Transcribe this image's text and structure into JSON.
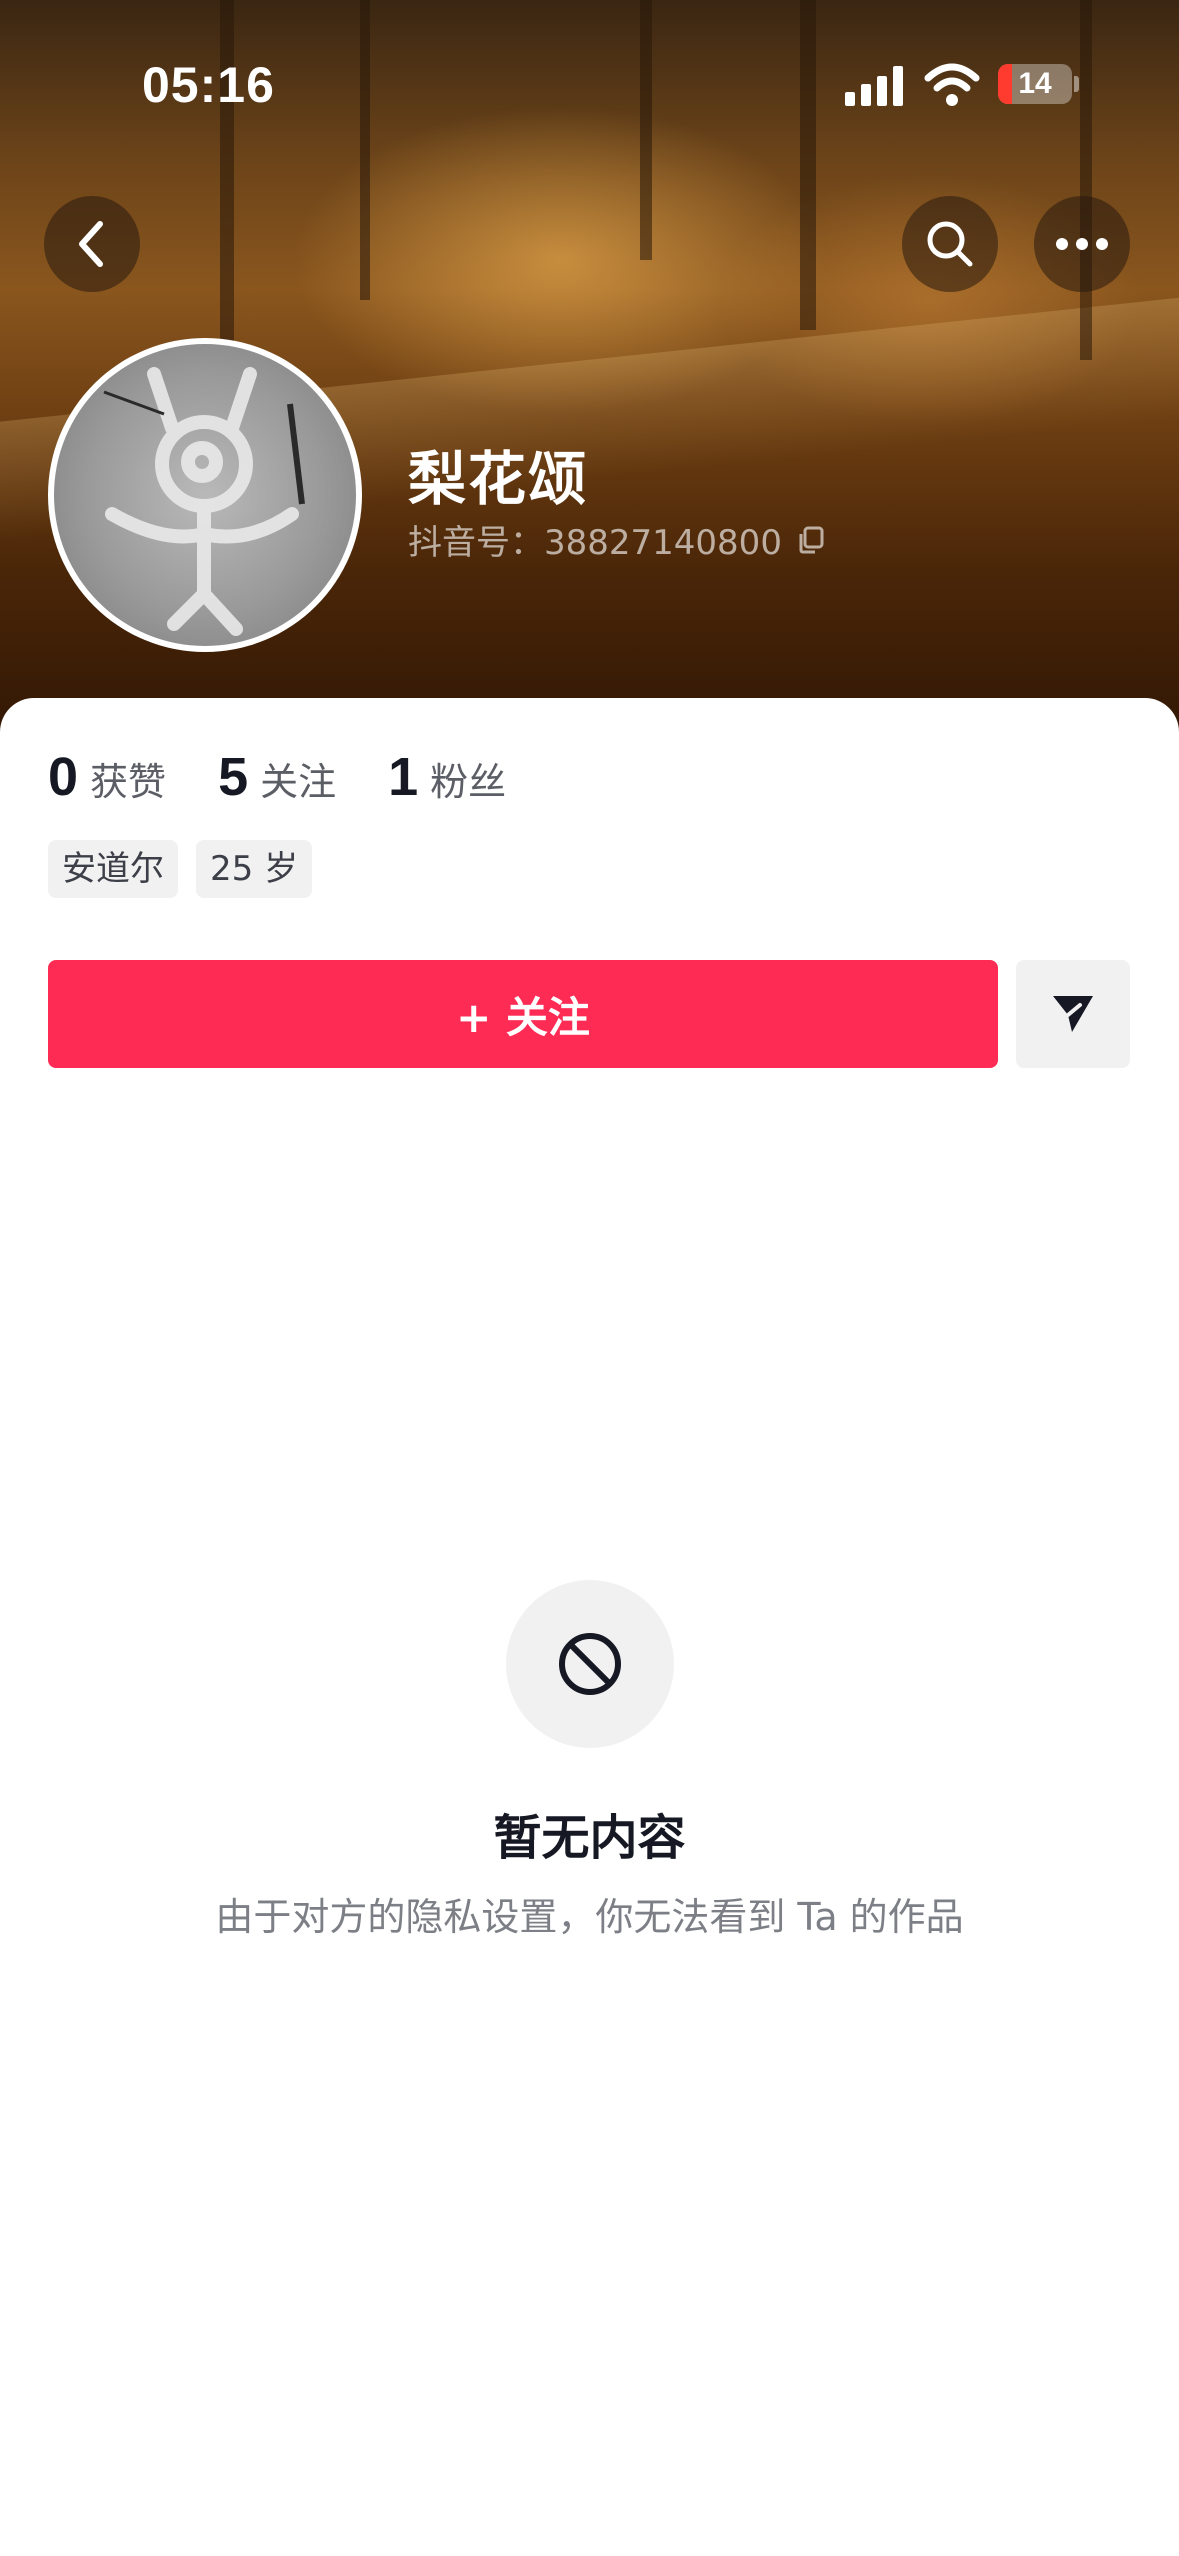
{
  "status_bar": {
    "time": "05:16",
    "battery": "14",
    "signal_icon": "cellular-signal-icon",
    "wifi_icon": "wifi-icon"
  },
  "nav": {
    "back_icon": "chevron-left-icon",
    "search_icon": "search-icon",
    "more_icon": "more-dots-icon"
  },
  "profile": {
    "name": "梨花颂",
    "douyin_id": "抖音号：38827140800",
    "copy_icon": "copy-icon"
  },
  "stats": [
    {
      "value": "0",
      "label": "获赞"
    },
    {
      "value": "5",
      "label": "关注"
    },
    {
      "value": "1",
      "label": "粉丝"
    }
  ],
  "tags": [
    "安道尔",
    "25 岁"
  ],
  "actions": {
    "follow_label": "+ 关注",
    "message_icon": "send-icon"
  },
  "empty_state": {
    "icon": "no-entry-icon",
    "title": "暂无内容",
    "description": "由于对方的隐私设置，你无法看到 Ta 的作品"
  },
  "colors": {
    "accent": "#fe2c55",
    "text_primary": "#161823",
    "text_secondary": "#7d7f86",
    "chip_bg": "#f1f1f2"
  }
}
